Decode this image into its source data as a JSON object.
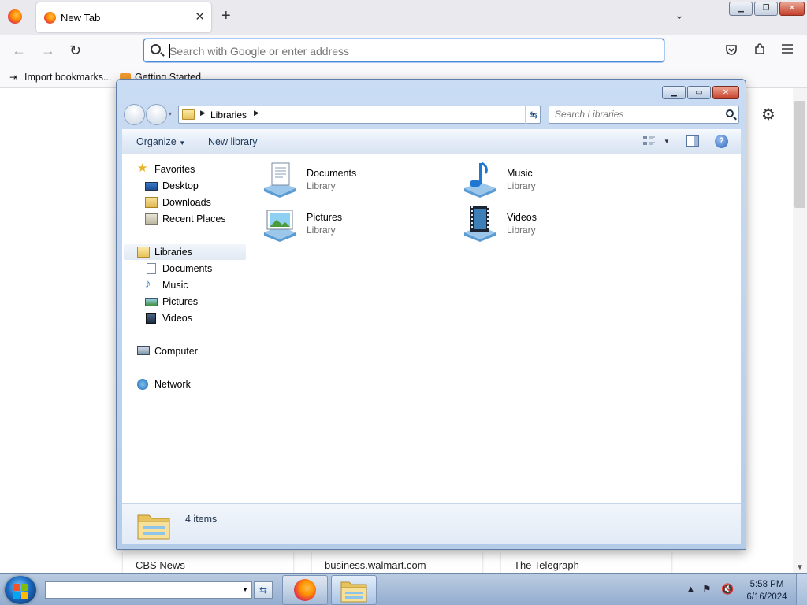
{
  "browser": {
    "tab_title": "New Tab",
    "close_tab": "✕",
    "new_tab": "+",
    "list_tabs": "⌄",
    "window_controls": {
      "minimize": "▁",
      "restore": "❐",
      "close": "✕"
    },
    "nav": {
      "back": "←",
      "forward": "→",
      "reload": "↻"
    },
    "url_placeholder": "Search with Google or enter address",
    "bookmarks": [
      {
        "label": "Import bookmarks..."
      },
      {
        "label": "Getting Started"
      }
    ],
    "top_sites": [
      "CBS News",
      "business.walmart.com",
      "The Telegraph"
    ]
  },
  "explorer": {
    "window_controls": {
      "minimize": "▁",
      "maximize": "▭",
      "close": "✕"
    },
    "breadcrumb": "Libraries",
    "search_placeholder": "Search Libraries",
    "toolbar": {
      "organize": "Organize",
      "new_library": "New library"
    },
    "nav_pane": {
      "favorites": "Favorites",
      "desktop": "Desktop",
      "downloads": "Downloads",
      "recent_places": "Recent Places",
      "libraries": "Libraries",
      "documents": "Documents",
      "music": "Music",
      "pictures": "Pictures",
      "videos": "Videos",
      "computer": "Computer",
      "network": "Network"
    },
    "libraries": [
      {
        "name": "Documents",
        "type": "Library"
      },
      {
        "name": "Music",
        "type": "Library"
      },
      {
        "name": "Pictures",
        "type": "Library"
      },
      {
        "name": "Videos",
        "type": "Library"
      }
    ],
    "status": "4 items"
  },
  "taskbar": {
    "time": "5:58 PM",
    "date": "6/16/2024"
  }
}
